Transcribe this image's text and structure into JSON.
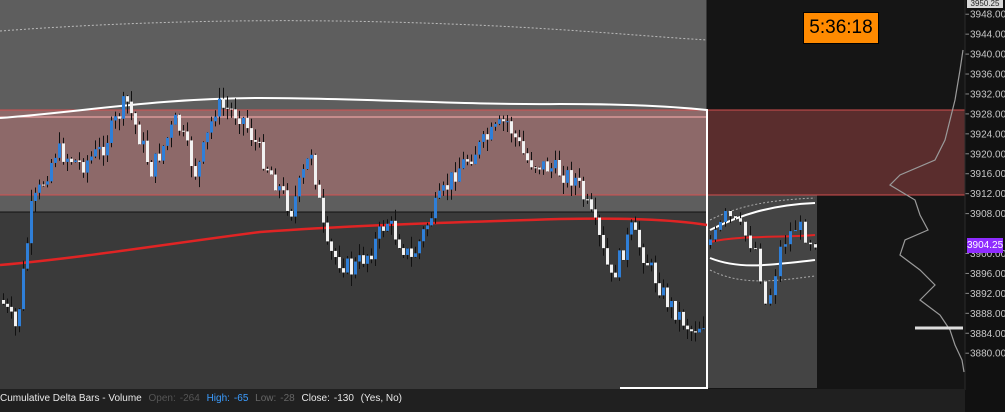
{
  "price_axis": {
    "top_partial": "3950.25",
    "labels": [
      "3948.00",
      "3944.00",
      "3940.00",
      "3936.00",
      "3932.00",
      "3928.00",
      "3924.00",
      "3920.00",
      "3916.00",
      "3912.00",
      "3908.00",
      "3900.00",
      "3896.00",
      "3892.00",
      "3888.00",
      "3884.00",
      "3880.00"
    ],
    "current_price": "3904.25",
    "current_price_color": "#8f2cff"
  },
  "timer": {
    "text": "5:36:18",
    "color": "#ff8a00"
  },
  "indicator": {
    "name": "Cumulative Delta Bars - Volume",
    "open_label": "Open:",
    "open_value": "-264",
    "high_label": "High:",
    "high_value": "-65",
    "low_label": "Low:",
    "low_value": "-28",
    "close_label": "Close:",
    "close_value": "-130",
    "params": "(Yes, No)"
  },
  "colors": {
    "up_candle": "#2f7fd8",
    "down_candle": "#f2f2f2",
    "resistance_zone": "#c77878",
    "moving_average": "#e02424",
    "vwap": "#ffffff"
  }
}
